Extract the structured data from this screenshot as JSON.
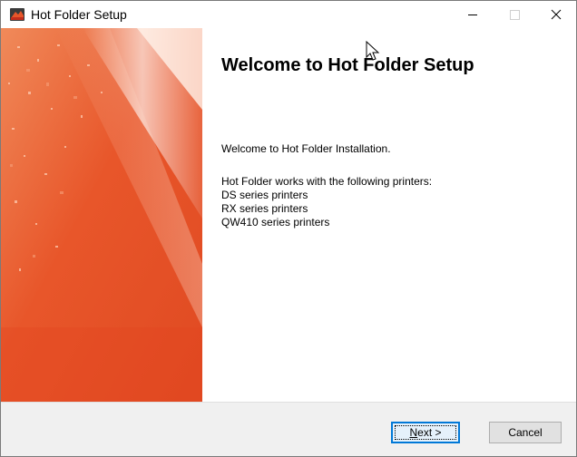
{
  "window": {
    "title": "Hot Folder Setup",
    "icon": "installer-app-icon"
  },
  "titlebar_controls": {
    "minimize_icon": "minimize-icon",
    "maximize_icon": "maximize-icon",
    "close_icon": "close-icon"
  },
  "content": {
    "heading": "Welcome to Hot Folder Setup",
    "intro": "Welcome to Hot Folder Installation.",
    "printers_intro": "Hot Folder works with the following printers:",
    "printers": [
      "DS series printers",
      "RX series printers",
      "QW410 series printers"
    ]
  },
  "buttons": {
    "next_label": "Next >",
    "next_mnemonic": "N",
    "next_rest": "ext >",
    "cancel_label": "Cancel"
  },
  "colors": {
    "banner_orange": "#e8562a",
    "banner_light": "#f7c7ae",
    "focus_blue": "#0078d7"
  }
}
